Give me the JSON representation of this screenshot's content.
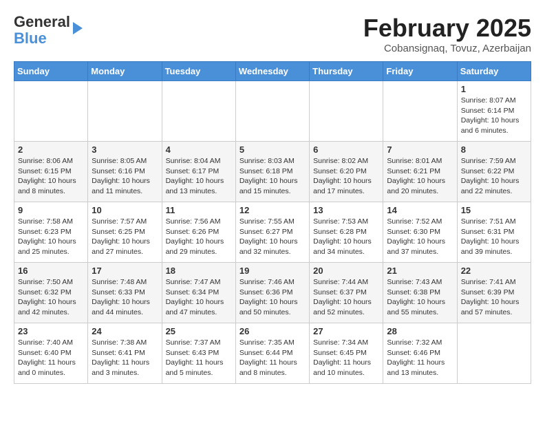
{
  "header": {
    "logo_general": "General",
    "logo_blue": "Blue",
    "month_title": "February 2025",
    "location": "Cobansignaq, Tovuz, Azerbaijan"
  },
  "weekdays": [
    "Sunday",
    "Monday",
    "Tuesday",
    "Wednesday",
    "Thursday",
    "Friday",
    "Saturday"
  ],
  "weeks": [
    [
      null,
      null,
      null,
      null,
      null,
      null,
      {
        "day": "1",
        "sunrise": "8:07 AM",
        "sunset": "6:14 PM",
        "daylight": "10 hours and 6 minutes."
      }
    ],
    [
      {
        "day": "2",
        "sunrise": "8:06 AM",
        "sunset": "6:15 PM",
        "daylight": "10 hours and 8 minutes."
      },
      {
        "day": "3",
        "sunrise": "8:05 AM",
        "sunset": "6:16 PM",
        "daylight": "10 hours and 11 minutes."
      },
      {
        "day": "4",
        "sunrise": "8:04 AM",
        "sunset": "6:17 PM",
        "daylight": "10 hours and 13 minutes."
      },
      {
        "day": "5",
        "sunrise": "8:03 AM",
        "sunset": "6:18 PM",
        "daylight": "10 hours and 15 minutes."
      },
      {
        "day": "6",
        "sunrise": "8:02 AM",
        "sunset": "6:20 PM",
        "daylight": "10 hours and 17 minutes."
      },
      {
        "day": "7",
        "sunrise": "8:01 AM",
        "sunset": "6:21 PM",
        "daylight": "10 hours and 20 minutes."
      },
      {
        "day": "8",
        "sunrise": "7:59 AM",
        "sunset": "6:22 PM",
        "daylight": "10 hours and 22 minutes."
      }
    ],
    [
      {
        "day": "9",
        "sunrise": "7:58 AM",
        "sunset": "6:23 PM",
        "daylight": "10 hours and 25 minutes."
      },
      {
        "day": "10",
        "sunrise": "7:57 AM",
        "sunset": "6:25 PM",
        "daylight": "10 hours and 27 minutes."
      },
      {
        "day": "11",
        "sunrise": "7:56 AM",
        "sunset": "6:26 PM",
        "daylight": "10 hours and 29 minutes."
      },
      {
        "day": "12",
        "sunrise": "7:55 AM",
        "sunset": "6:27 PM",
        "daylight": "10 hours and 32 minutes."
      },
      {
        "day": "13",
        "sunrise": "7:53 AM",
        "sunset": "6:28 PM",
        "daylight": "10 hours and 34 minutes."
      },
      {
        "day": "14",
        "sunrise": "7:52 AM",
        "sunset": "6:30 PM",
        "daylight": "10 hours and 37 minutes."
      },
      {
        "day": "15",
        "sunrise": "7:51 AM",
        "sunset": "6:31 PM",
        "daylight": "10 hours and 39 minutes."
      }
    ],
    [
      {
        "day": "16",
        "sunrise": "7:50 AM",
        "sunset": "6:32 PM",
        "daylight": "10 hours and 42 minutes."
      },
      {
        "day": "17",
        "sunrise": "7:48 AM",
        "sunset": "6:33 PM",
        "daylight": "10 hours and 44 minutes."
      },
      {
        "day": "18",
        "sunrise": "7:47 AM",
        "sunset": "6:34 PM",
        "daylight": "10 hours and 47 minutes."
      },
      {
        "day": "19",
        "sunrise": "7:46 AM",
        "sunset": "6:36 PM",
        "daylight": "10 hours and 50 minutes."
      },
      {
        "day": "20",
        "sunrise": "7:44 AM",
        "sunset": "6:37 PM",
        "daylight": "10 hours and 52 minutes."
      },
      {
        "day": "21",
        "sunrise": "7:43 AM",
        "sunset": "6:38 PM",
        "daylight": "10 hours and 55 minutes."
      },
      {
        "day": "22",
        "sunrise": "7:41 AM",
        "sunset": "6:39 PM",
        "daylight": "10 hours and 57 minutes."
      }
    ],
    [
      {
        "day": "23",
        "sunrise": "7:40 AM",
        "sunset": "6:40 PM",
        "daylight": "11 hours and 0 minutes."
      },
      {
        "day": "24",
        "sunrise": "7:38 AM",
        "sunset": "6:41 PM",
        "daylight": "11 hours and 3 minutes."
      },
      {
        "day": "25",
        "sunrise": "7:37 AM",
        "sunset": "6:43 PM",
        "daylight": "11 hours and 5 minutes."
      },
      {
        "day": "26",
        "sunrise": "7:35 AM",
        "sunset": "6:44 PM",
        "daylight": "11 hours and 8 minutes."
      },
      {
        "day": "27",
        "sunrise": "7:34 AM",
        "sunset": "6:45 PM",
        "daylight": "11 hours and 10 minutes."
      },
      {
        "day": "28",
        "sunrise": "7:32 AM",
        "sunset": "6:46 PM",
        "daylight": "11 hours and 13 minutes."
      },
      null
    ]
  ]
}
